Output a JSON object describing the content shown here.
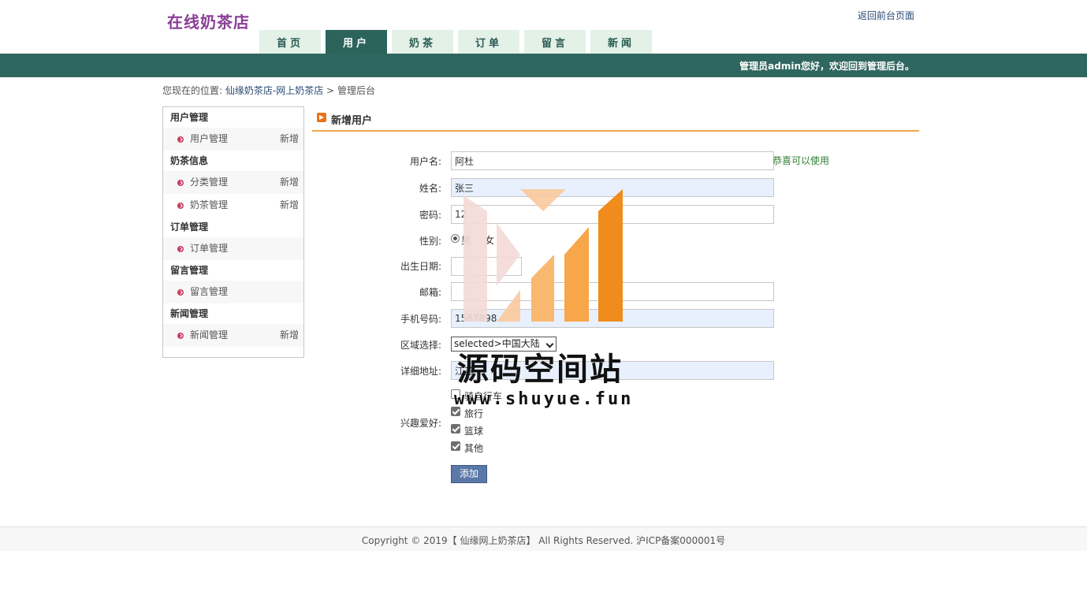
{
  "header": {
    "site_title": "在线奶茶店",
    "back_link": "返回前台页面",
    "welcome": "管理员admin您好，欢迎回到管理后台。"
  },
  "nav": {
    "tabs": [
      {
        "label": "首页",
        "active": false
      },
      {
        "label": "用户",
        "active": true
      },
      {
        "label": "奶茶",
        "active": false
      },
      {
        "label": "订单",
        "active": false
      },
      {
        "label": "留言",
        "active": false
      },
      {
        "label": "新闻",
        "active": false
      }
    ]
  },
  "breadcrumb": {
    "prefix": "您现在的位置:",
    "link": "仙缘奶茶店-网上奶茶店",
    "sep": ">",
    "current": "管理后台"
  },
  "sidebar": {
    "groups": [
      {
        "title": "用户管理",
        "items": [
          {
            "label": "用户管理",
            "add": "新增"
          }
        ]
      },
      {
        "title": "奶茶信息",
        "items": [
          {
            "label": "分类管理",
            "add": "新增"
          },
          {
            "label": "奶茶管理",
            "add": "新增"
          }
        ]
      },
      {
        "title": "订单管理",
        "items": [
          {
            "label": "订单管理",
            "add": ""
          }
        ]
      },
      {
        "title": "留言管理",
        "items": [
          {
            "label": "留言管理",
            "add": ""
          }
        ]
      },
      {
        "title": "新闻管理",
        "items": [
          {
            "label": "新闻管理",
            "add": "新增"
          }
        ]
      }
    ]
  },
  "form": {
    "title": "新增用户",
    "username_label": "用户名:",
    "username_value": "阿杜",
    "username_hint": "恭喜可以使用",
    "name_label": "姓名:",
    "name_value": "张三",
    "password_label": "密码:",
    "password_value": "12",
    "gender_label": "性别:",
    "gender_male": "男",
    "gender_female": "女",
    "birth_label": "出生日期:",
    "email_label": "邮箱:",
    "phone_label": "手机号码:",
    "phone_value": "1567898",
    "region_label": "区域选择:",
    "region_value": "selected>中国大陆",
    "address_label": "详细地址:",
    "address_value": "江苏",
    "hobby_label": "兴趣爱好:",
    "hobbies": [
      {
        "label": "骑自行车",
        "checked": false
      },
      {
        "label": "旅行",
        "checked": true
      },
      {
        "label": "篮球",
        "checked": true
      },
      {
        "label": "其他",
        "checked": true
      }
    ],
    "submit": "添加"
  },
  "footer": {
    "text": "Copyright © 2019【 仙缘网上奶茶店】 All Rights Reserved. 沪ICP备案000001号"
  },
  "watermark": {
    "text": "源码空间站",
    "url": "www.shuyue.fun",
    "colors": [
      "#f3d9d6",
      "#f9c99c",
      "#f7a64a",
      "#f08c1c"
    ]
  }
}
